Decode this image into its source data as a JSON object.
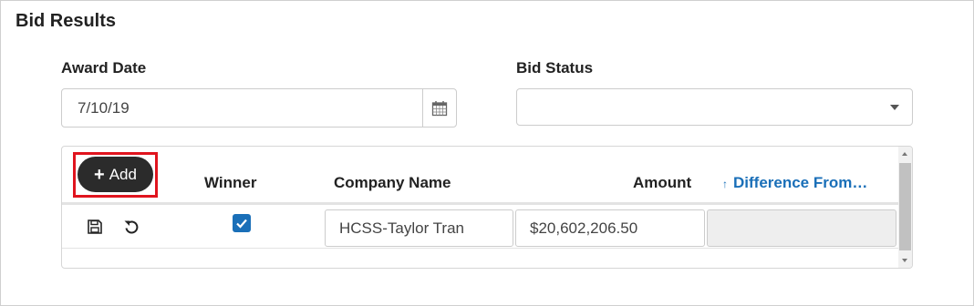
{
  "section": {
    "title": "Bid Results"
  },
  "award_date": {
    "label": "Award Date",
    "value": "7/10/19",
    "icon": "calendar-icon"
  },
  "bid_status": {
    "label": "Bid Status",
    "value": "",
    "icon": "caret-down-icon"
  },
  "grid": {
    "add_button": {
      "label": "Add",
      "icon": "plus-icon"
    },
    "columns": {
      "winner": "Winner",
      "company_name": "Company Name",
      "amount": "Amount",
      "difference": "Difference From…"
    },
    "sort_icon": "arrow-up-icon",
    "rows": [
      {
        "save_icon": "save-icon",
        "undo_icon": "undo-icon",
        "winner_checked": true,
        "company_name": "HCSS-Taylor Tran",
        "amount": "$20,602,206.50",
        "difference": ""
      }
    ]
  },
  "colors": {
    "accent": "#1a6fb8",
    "highlight": "#e0141e",
    "button_dark": "#2b2b2b"
  }
}
